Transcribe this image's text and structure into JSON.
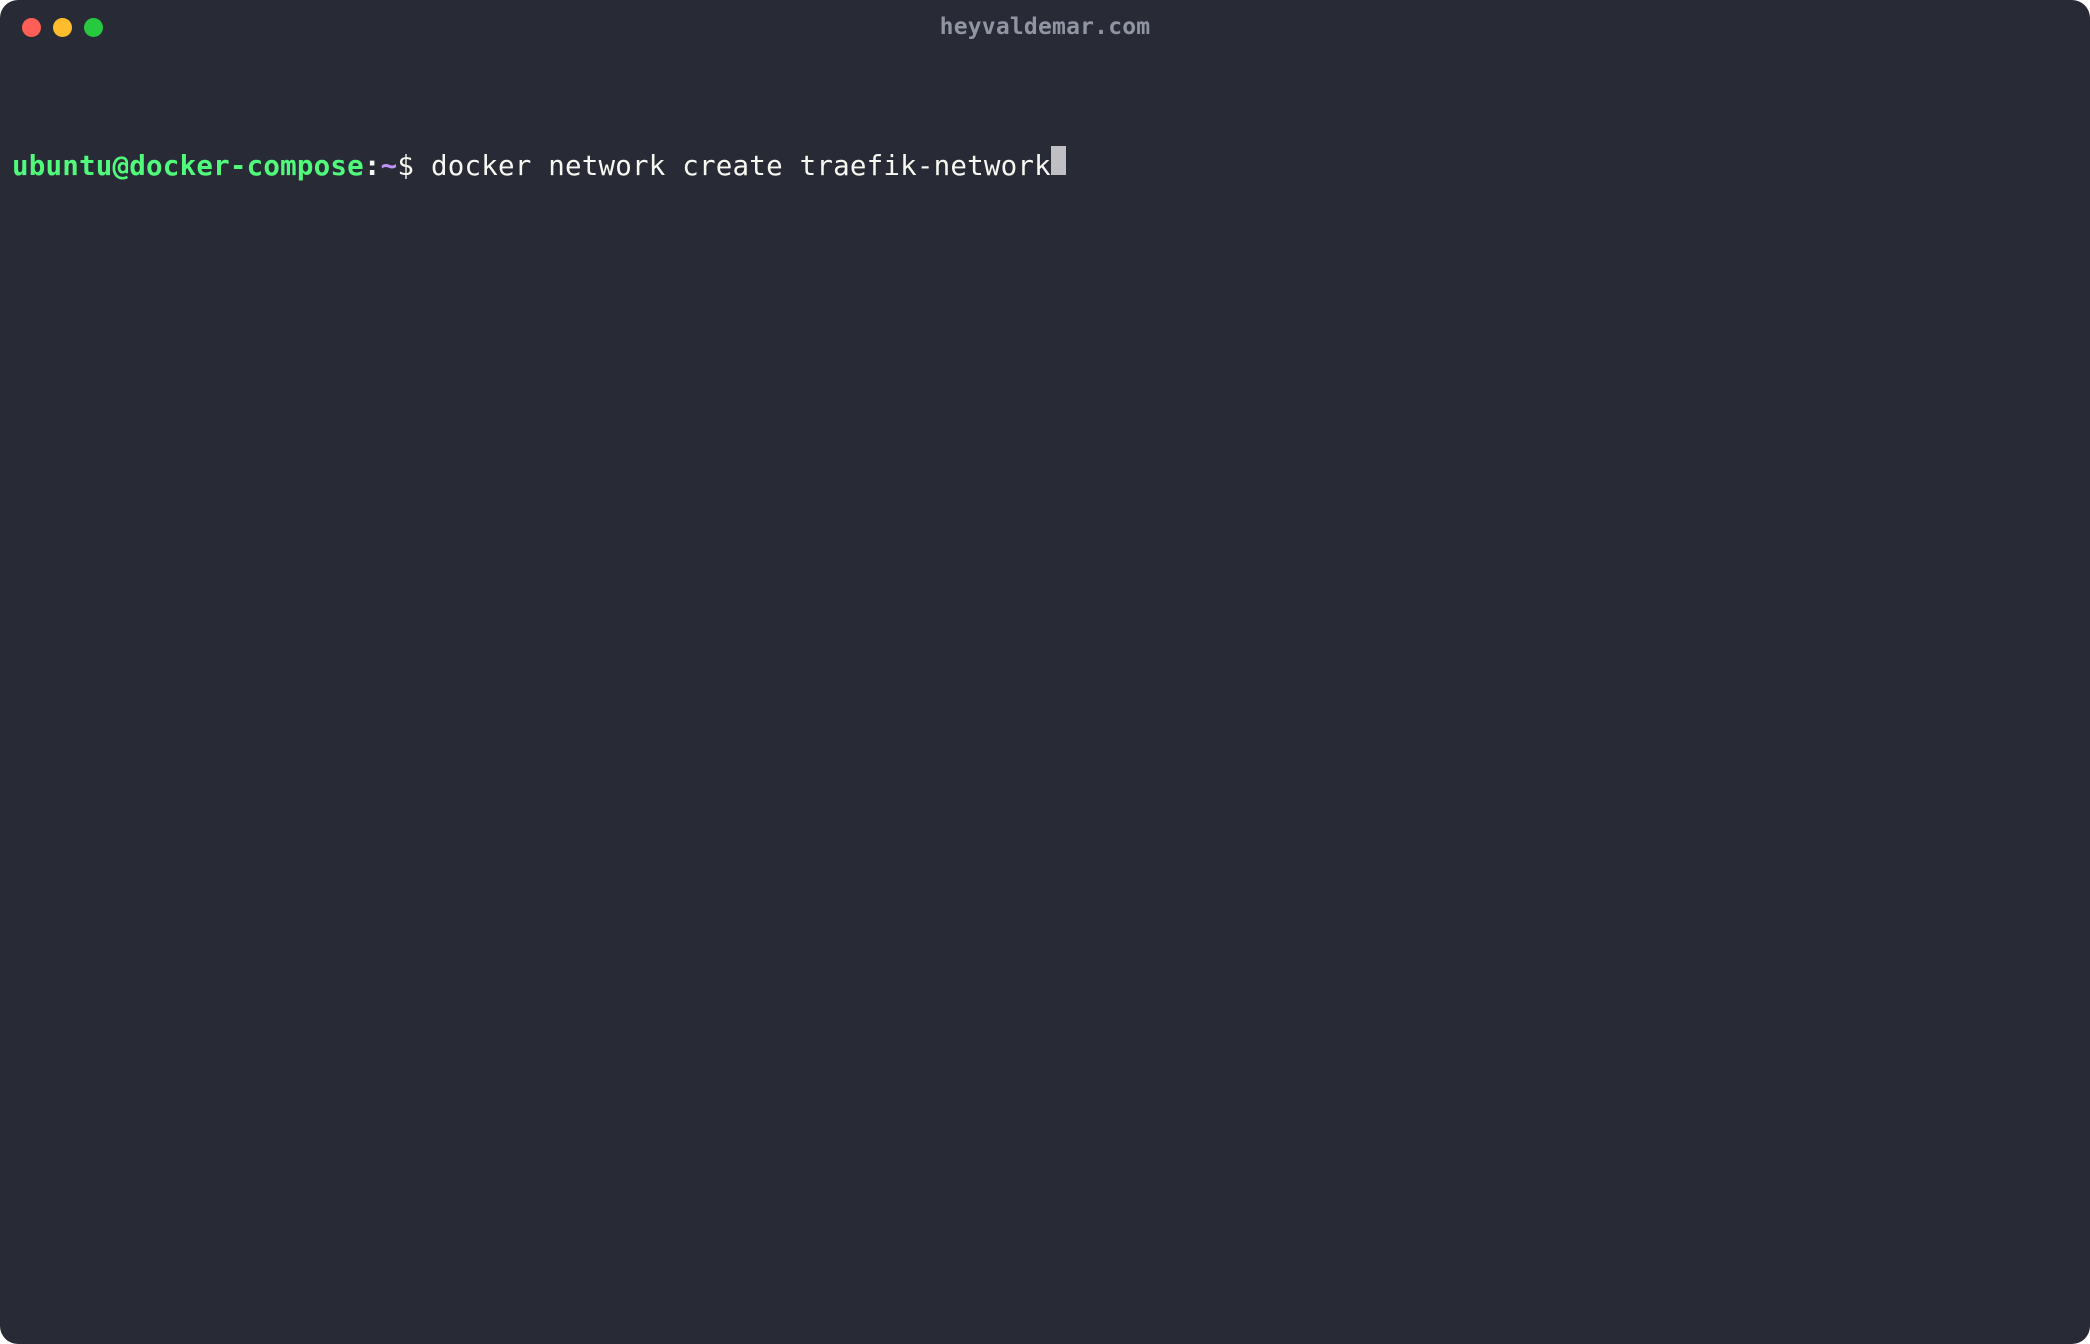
{
  "window": {
    "title": "heyvaldemar.com"
  },
  "prompt": {
    "user_host": "ubuntu@docker-compose",
    "colon": ":",
    "path": "~",
    "symbol": "$ "
  },
  "command": {
    "text": "docker network create traefik-network"
  },
  "colors": {
    "background": "#282a36",
    "prompt_user": "#50fa7b",
    "prompt_path": "#bd93f9",
    "text": "#f8f8f2",
    "title": "#9094a3",
    "close": "#ff5f56",
    "minimize": "#ffbd2e",
    "maximize": "#27c93f"
  }
}
